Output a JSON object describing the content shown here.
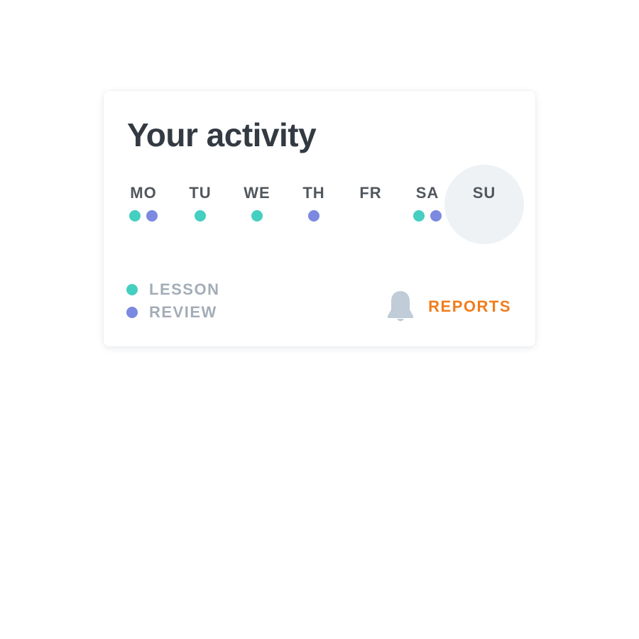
{
  "card": {
    "title": "Your activity"
  },
  "days": [
    {
      "label": "MO",
      "activities": [
        "lesson",
        "review"
      ],
      "today": false
    },
    {
      "label": "TU",
      "activities": [
        "lesson"
      ],
      "today": false
    },
    {
      "label": "WE",
      "activities": [
        "lesson"
      ],
      "today": false
    },
    {
      "label": "TH",
      "activities": [
        "review"
      ],
      "today": false
    },
    {
      "label": "FR",
      "activities": [],
      "today": false
    },
    {
      "label": "SA",
      "activities": [
        "lesson",
        "review"
      ],
      "today": false
    },
    {
      "label": "SU",
      "activities": [],
      "today": true
    }
  ],
  "legend": {
    "lesson": {
      "label": "LESSON",
      "color": "#45cfc1"
    },
    "review": {
      "label": "REVIEW",
      "color": "#7b89e0"
    }
  },
  "reports": {
    "label": "REPORTS",
    "icon": "bell-icon",
    "color": "#f27c1b",
    "icon_color": "#c0ccd8"
  },
  "colors": {
    "today_highlight": "#eef2f5",
    "title": "#333a42",
    "day_label": "#51575e",
    "legend_label": "#a3adb7"
  }
}
